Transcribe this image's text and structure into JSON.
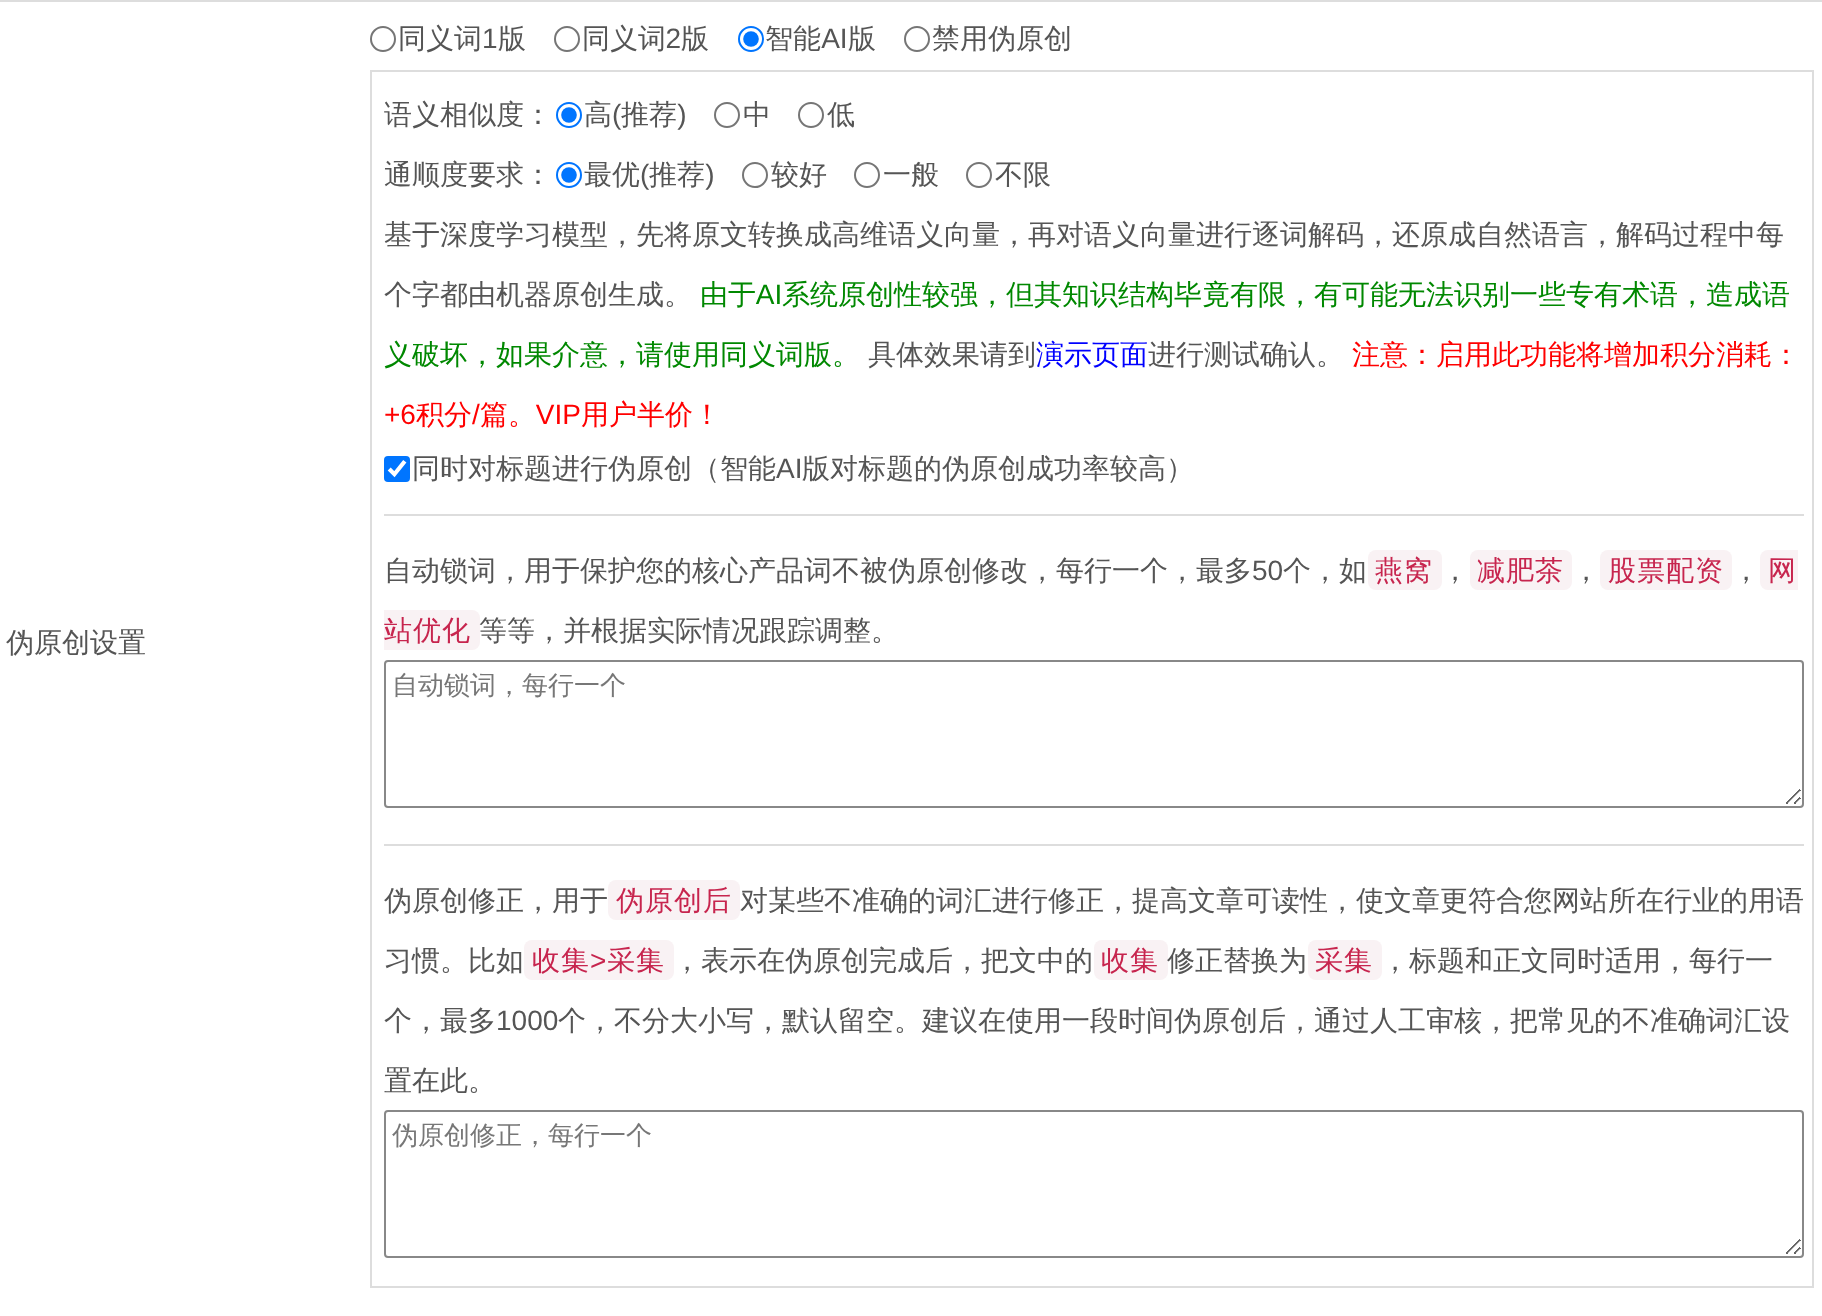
{
  "mode_options": [
    {
      "label": "同义词1版",
      "selected": false
    },
    {
      "label": "同义词2版",
      "selected": false
    },
    {
      "label": "智能AI版",
      "selected": true
    },
    {
      "label": "禁用伪原创",
      "selected": false
    }
  ],
  "section_label": "伪原创设置",
  "ai_settings": {
    "rows": [
      {
        "label": "语义相似度：",
        "options": [
          {
            "label": "高(推荐)",
            "selected": true
          },
          {
            "label": "中",
            "selected": false
          },
          {
            "label": "低",
            "selected": false
          }
        ]
      },
      {
        "label": "通顺度要求：",
        "options": [
          {
            "label": "最优(推荐)",
            "selected": true
          },
          {
            "label": "较好",
            "selected": false
          },
          {
            "label": "一般",
            "selected": false
          },
          {
            "label": "不限",
            "selected": false
          }
        ]
      }
    ],
    "description": [
      {
        "kind": "text",
        "text": "基于深度学习模型，先将原文转换成高维语义向量，再对语义向量进行逐词解码，还原成自然语言，解码过程中每个字都由机器原创生成。 "
      },
      {
        "kind": "green",
        "text": "由于AI系统原创性较强，但其知识结构毕竟有限，有可能无法识别一些专有术语，造成语义破坏，如果介意，请使用同义词版。"
      },
      {
        "kind": "text",
        "text": " 具体效果请到"
      },
      {
        "kind": "link",
        "text": "演示页面"
      },
      {
        "kind": "text",
        "text": "进行测试确认。 "
      },
      {
        "kind": "red",
        "text": "注意：启用此功能将增加积分消耗：+6积分/篇。VIP用户半价！"
      }
    ],
    "title_checkbox": {
      "label": "同时对标题进行伪原创（智能AI版对标题的伪原创成功率较高）",
      "checked": true
    }
  },
  "lock_words": {
    "description": [
      {
        "kind": "text",
        "text": "自动锁词，用于保护您的核心产品词不被伪原创修改，每行一个，最多50个，如"
      },
      {
        "kind": "code",
        "text": "燕窝"
      },
      {
        "kind": "text",
        "text": "，"
      },
      {
        "kind": "code",
        "text": "减肥茶"
      },
      {
        "kind": "text",
        "text": "，"
      },
      {
        "kind": "code",
        "text": "股票配资"
      },
      {
        "kind": "text",
        "text": "，"
      },
      {
        "kind": "code",
        "text": "网站优化"
      },
      {
        "kind": "text",
        "text": "等等，并根据实际情况跟踪调整。"
      }
    ],
    "placeholder": "自动锁词，每行一个"
  },
  "correction": {
    "description": [
      {
        "kind": "text",
        "text": "伪原创修正，用于"
      },
      {
        "kind": "code",
        "text": "伪原创后"
      },
      {
        "kind": "text",
        "text": "对某些不准确的词汇进行修正，提高文章可读性，使文章更符合您网站所在行业的用语习惯。比如"
      },
      {
        "kind": "code",
        "text": "收集>采集"
      },
      {
        "kind": "text",
        "text": "，表示在伪原创完成后，把文中的"
      },
      {
        "kind": "code",
        "text": "收集"
      },
      {
        "kind": "text",
        "text": "修正替换为"
      },
      {
        "kind": "code",
        "text": "采集"
      },
      {
        "kind": "text",
        "text": "，标题和正文同时适用，每行一个，最多1000个，不分大小写，默认留空。建议在使用一段时间伪原创后，通过人工审核，把常见的不准确词汇设置在此。"
      }
    ],
    "placeholder": "伪原创修正，每行一个"
  }
}
